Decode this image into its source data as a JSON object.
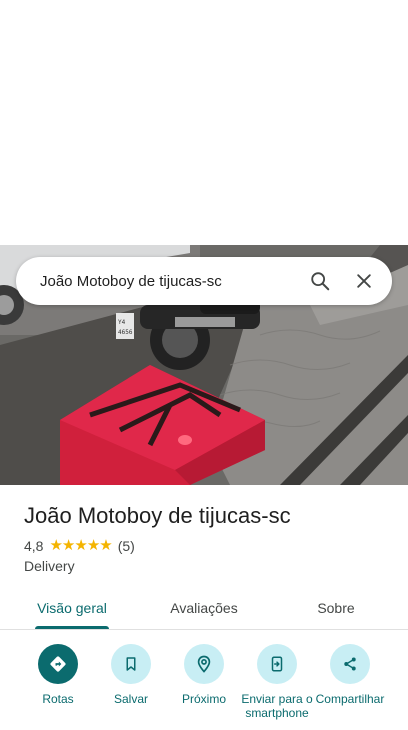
{
  "search": {
    "query": "João Motoboy de tijucas-sc",
    "search_icon": "search-icon",
    "close_icon": "close-icon"
  },
  "photo": {
    "plate_text": "Y 4  4656"
  },
  "place": {
    "title": "João Motoboy de tijucas-sc",
    "rating": "4,8",
    "stars": 5,
    "review_count": "(5)",
    "category": "Delivery"
  },
  "tabs": [
    {
      "label": "Visão geral",
      "active": true
    },
    {
      "label": "Avaliações",
      "active": false
    },
    {
      "label": "Sobre",
      "active": false
    }
  ],
  "actions": [
    {
      "label": "Rotas",
      "icon": "directions-icon"
    },
    {
      "label": "Salvar",
      "icon": "bookmark-icon"
    },
    {
      "label": "Próximo",
      "icon": "nearby-icon"
    },
    {
      "label": "Enviar para o smartphone",
      "icon": "send-to-phone-icon"
    },
    {
      "label": "Compartilhar",
      "icon": "share-icon"
    }
  ],
  "colors": {
    "accent": "#0b6b6e",
    "action_bg": "#c8eef4",
    "star": "#f4b400"
  }
}
